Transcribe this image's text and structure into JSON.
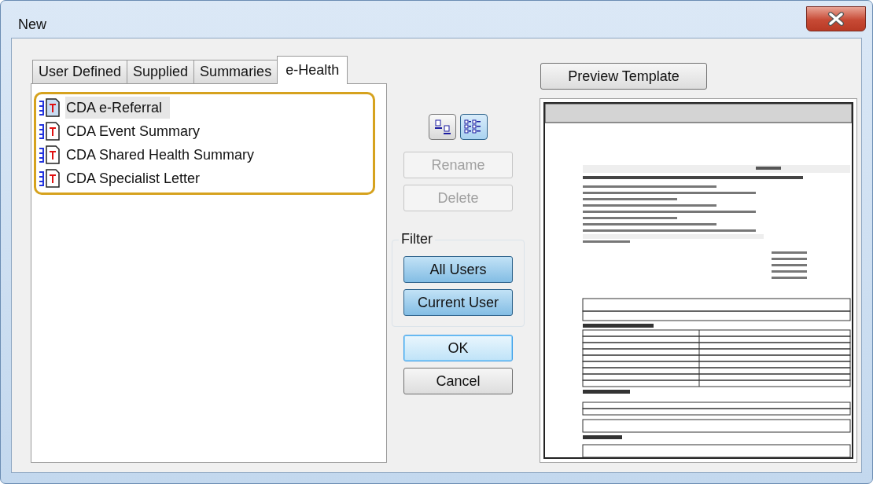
{
  "window": {
    "title": "New"
  },
  "tabs": [
    {
      "label": "User Defined",
      "selected": false
    },
    {
      "label": "Supplied",
      "selected": false
    },
    {
      "label": "Summaries",
      "selected": false
    },
    {
      "label": "e-Health",
      "selected": true
    }
  ],
  "templates": [
    {
      "name": "CDA e-Referral",
      "selected": true
    },
    {
      "name": "CDA Event Summary",
      "selected": false
    },
    {
      "name": "CDA Shared Health Summary",
      "selected": false
    },
    {
      "name": "CDA Specialist Letter",
      "selected": false
    }
  ],
  "view_toggles": [
    {
      "kind": "single",
      "selected": false
    },
    {
      "kind": "list",
      "selected": true
    }
  ],
  "actions": [
    {
      "label": "Rename",
      "disabled": true
    },
    {
      "label": "Delete",
      "disabled": true
    }
  ],
  "filter": {
    "title": "Filter",
    "options": [
      {
        "label": "All Users",
        "selected": true
      },
      {
        "label": "Current User",
        "selected": true
      }
    ]
  },
  "dialog_buttons": [
    {
      "label": "OK",
      "default": true
    },
    {
      "label": "Cancel",
      "default": false
    }
  ],
  "preview": {
    "button": "Preview Template"
  }
}
